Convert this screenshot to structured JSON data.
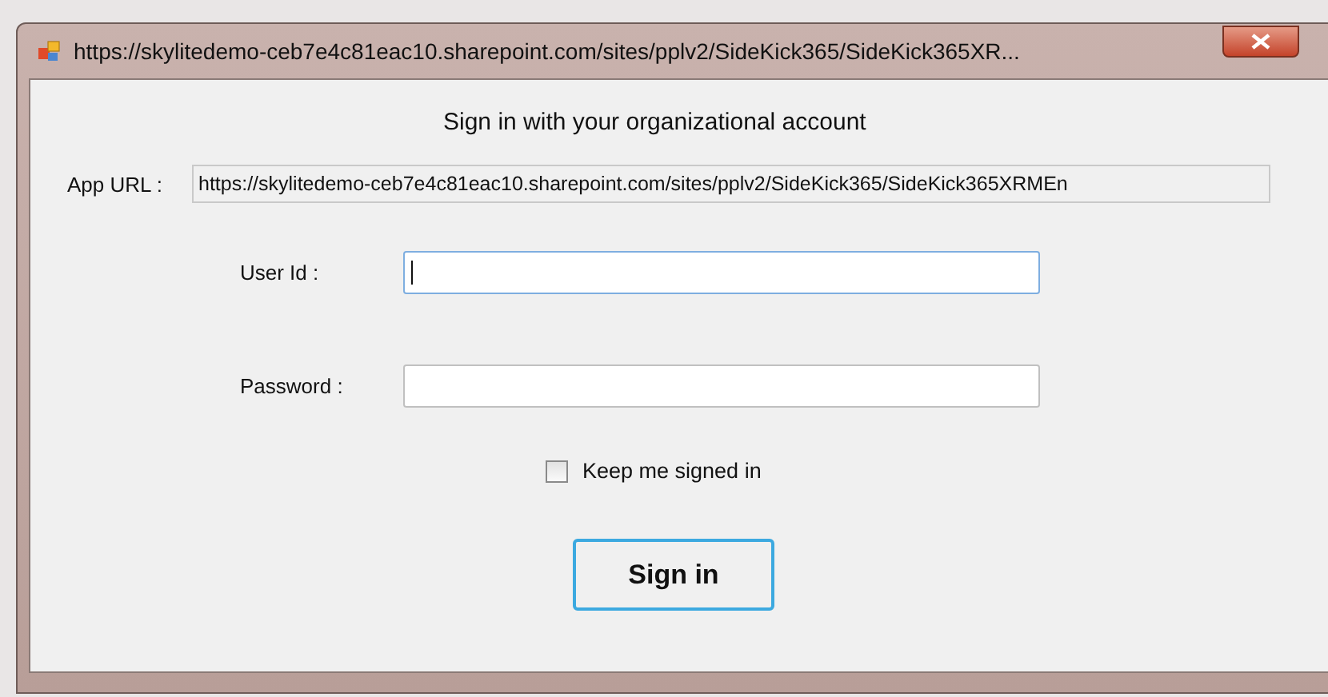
{
  "window": {
    "title": "https://skylitedemo-ceb7e4c81eac10.sharepoint.com/sites/pplv2/SideKick365/SideKick365XR..."
  },
  "heading": "Sign in with your organizational account",
  "app_url": {
    "label": "App URL :",
    "value": "https://skylitedemo-ceb7e4c81eac10.sharepoint.com/sites/pplv2/SideKick365/SideKick365XRMEn"
  },
  "fields": [
    {
      "label": "User Id :",
      "focused": true
    },
    {
      "label": "Password :",
      "focused": false
    }
  ],
  "keep_signed_in": {
    "label": "Keep me signed in",
    "checked": false
  },
  "buttons": [
    {
      "label": "Sign in",
      "focused": true
    }
  ]
}
